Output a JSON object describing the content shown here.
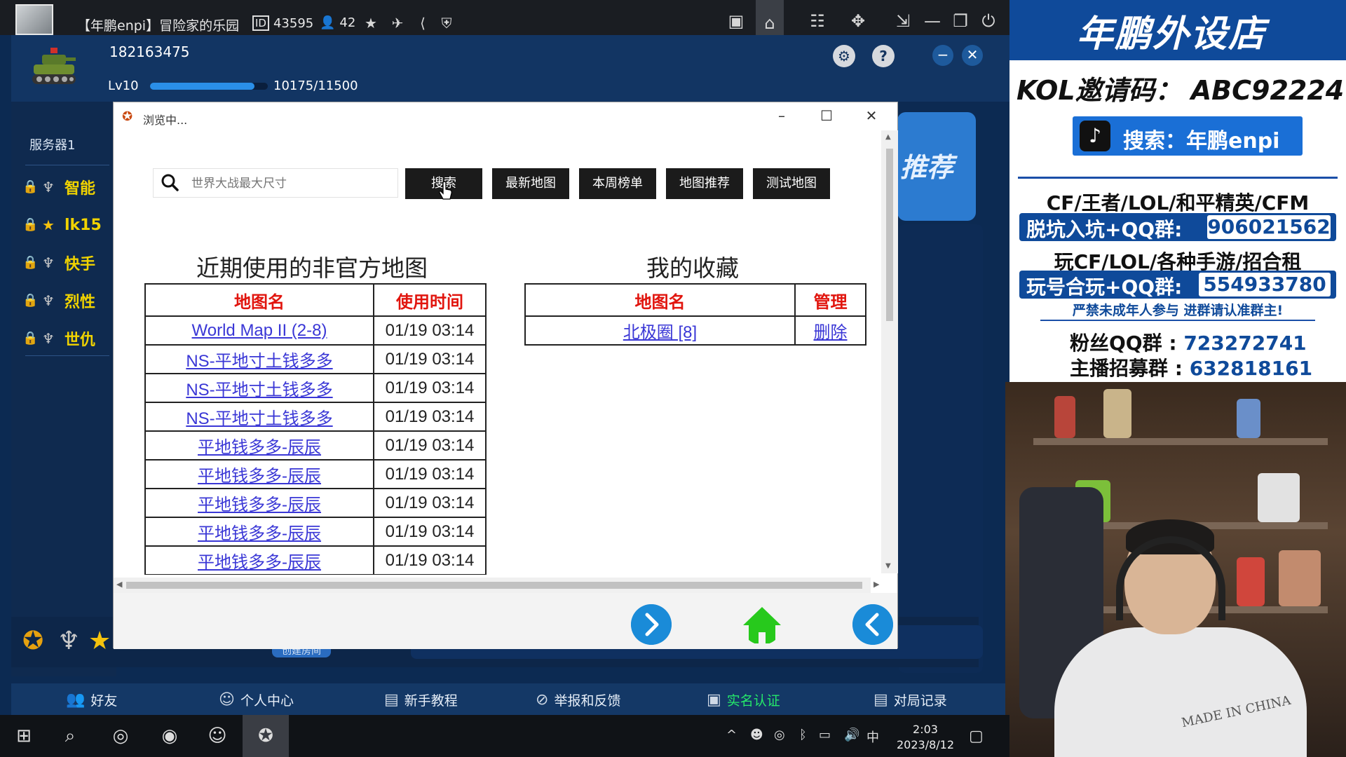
{
  "topbar": {
    "title": "【年鹏enpi】冒险家的乐园",
    "id_label": "43595",
    "players": "42"
  },
  "header": {
    "user_id": "182163475",
    "level": "Lv10",
    "xp": "10175/11500",
    "xp_progress": 0.885
  },
  "sidebar": {
    "server": "服务器1",
    "items": [
      {
        "name": "智能",
        "rank": "wings"
      },
      {
        "name": "lk15",
        "rank": "star"
      },
      {
        "name": "快手",
        "rank": "wings"
      },
      {
        "name": "烈性",
        "rank": "wings"
      },
      {
        "name": "世仇",
        "rank": "wings"
      }
    ]
  },
  "right_panel": {
    "label": "推荐"
  },
  "bottom_strip": {
    "create_room": "创建房间"
  },
  "footer": {
    "items": [
      {
        "label": "好友",
        "icon": "friends-icon"
      },
      {
        "label": "个人中心",
        "icon": "profile-icon"
      },
      {
        "label": "新手教程",
        "icon": "tutorial-icon"
      },
      {
        "label": "举报和反馈",
        "icon": "report-icon"
      },
      {
        "label": "实名认证",
        "icon": "verify-icon"
      },
      {
        "label": "对局记录",
        "icon": "record-icon"
      }
    ]
  },
  "dialog": {
    "title": "浏览中...",
    "search_placeholder": "世界大战最大尺寸",
    "buttons": [
      "搜索",
      "最新地图",
      "本周榜单",
      "地图推荐",
      "测试地图"
    ],
    "recent_title": "近期使用的非官方地图",
    "recent_headers": [
      "地图名",
      "使用时间"
    ],
    "recent_rows": [
      {
        "name": "World Map II (2-8)",
        "time": "01/19 03:14"
      },
      {
        "name": "NS-平地寸土钱多多",
        "time": "01/19 03:14"
      },
      {
        "name": "NS-平地寸土钱多多",
        "time": "01/19 03:14"
      },
      {
        "name": "NS-平地寸土钱多多",
        "time": "01/19 03:14"
      },
      {
        "name": "平地钱多多-辰辰",
        "time": "01/19 03:14"
      },
      {
        "name": "平地钱多多-辰辰",
        "time": "01/19 03:14"
      },
      {
        "name": "平地钱多多-辰辰",
        "time": "01/19 03:14"
      },
      {
        "name": "平地钱多多-辰辰",
        "time": "01/19 03:14"
      },
      {
        "name": "平地钱多多-辰辰",
        "time": "01/19 03:14"
      }
    ],
    "fav_title": "我的收藏",
    "fav_headers": [
      "地图名",
      "管理"
    ],
    "fav_rows": [
      {
        "name": "北极圈 [8]",
        "action": "删除"
      }
    ]
  },
  "stream": {
    "shop": "年鹏外设店",
    "kol": "KOL邀请码： ABC92224",
    "tiktok": "搜索：年鹏enpi",
    "games": "CF/王者/LOL/和平精英/CFM",
    "qq1_label": "脱坑入坑+QQ群:",
    "qq1_number": "906021562",
    "rent": "玩CF/LOL/各种手游/招合租",
    "qq2_label": "玩号合玩+QQ群:",
    "qq2_number": "554933780",
    "warning": "严禁未成年人参与  进群请认准群主!",
    "fans_label": "粉丝QQ群 :",
    "fans_number": "723272741",
    "recruit_label": "主播招募群 :",
    "recruit_number": "632818161",
    "shirt_text": "MADE IN CHINA"
  },
  "taskbar": {
    "time": "2:03",
    "date": "2023/8/12",
    "ime": "中"
  },
  "colors": {
    "link": "#3a37d6",
    "header_red": "#e1150e",
    "accent_blue": "#1a8bd8",
    "home_green": "#27c91c"
  }
}
